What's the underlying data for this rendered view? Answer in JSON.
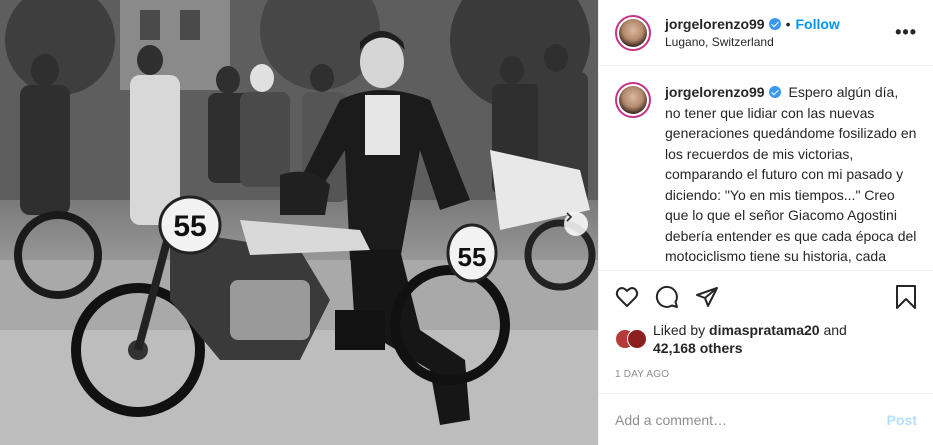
{
  "post": {
    "username": "jorgelorenzo99",
    "location": "Lugano, Switzerland",
    "follow_label": "Follow",
    "separator": "•",
    "more_label": "•••",
    "caption": "Espero algún día, no tener que lidiar con las nuevas generaciones quedándome fosilizado en los recuerdos de mis victorias, comparando el futuro con mi pasado y diciendo: \"Yo en mis tiempos...\" Creo que lo que el señor Giacomo Agostini debería entender es que cada época del motociclismo tiene su historia, cada campeón tiene su importancia en",
    "photo": {
      "bike_number_front": "55",
      "bike_number_side": "55"
    }
  },
  "actions": {
    "liked_by_prefix": "Liked by",
    "liked_by_user": "dimaspratama20",
    "liked_by_and": "and",
    "others_count": "42,168 others",
    "date": "1 DAY AGO"
  },
  "comment": {
    "placeholder": "Add a comment…",
    "post_label": "Post"
  },
  "colors": {
    "link_blue": "#0095f6",
    "verified_blue": "#3897f0",
    "post_disabled": "#b2dffc",
    "muted_text": "#8e8e8e"
  },
  "icons": [
    "heart-icon",
    "comment-icon",
    "share-icon",
    "bookmark-icon",
    "verified-icon",
    "chevron-right-icon",
    "more-icon"
  ]
}
